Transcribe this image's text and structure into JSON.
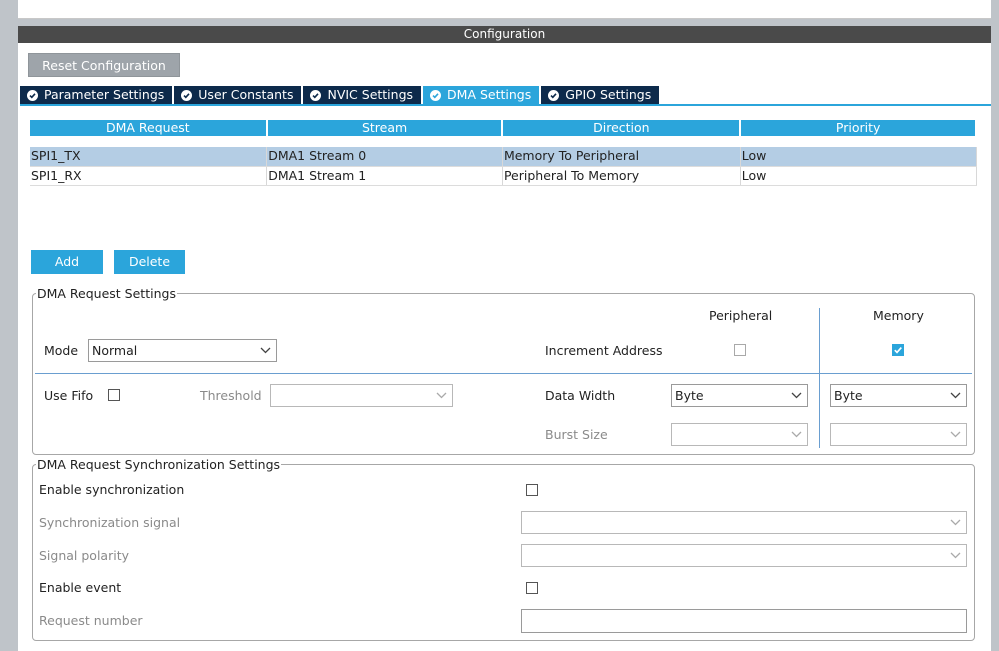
{
  "config": {
    "header": "Configuration",
    "reset_label": "Reset Configuration",
    "tabs": [
      {
        "label": "Parameter Settings"
      },
      {
        "label": "User Constants"
      },
      {
        "label": "NVIC Settings"
      },
      {
        "label": "DMA Settings",
        "active": true
      },
      {
        "label": "GPIO Settings"
      }
    ]
  },
  "dma_table": {
    "columns": [
      "DMA Request",
      "Stream",
      "Direction",
      "Priority"
    ],
    "rows": [
      {
        "request": "SPI1_TX",
        "stream": "DMA1 Stream 0",
        "direction": "Memory To Peripheral",
        "priority": "Low",
        "selected": true
      },
      {
        "request": "SPI1_RX",
        "stream": "DMA1 Stream 1",
        "direction": "Peripheral To Memory",
        "priority": "Low",
        "selected": false
      }
    ]
  },
  "buttons": {
    "add": "Add",
    "delete": "Delete"
  },
  "request_settings": {
    "title": "DMA Request Settings",
    "peripheral_header": "Peripheral",
    "memory_header": "Memory",
    "mode_label": "Mode",
    "mode_value": "Normal",
    "increment_label": "Increment Address",
    "peripheral_increment": false,
    "memory_increment": true,
    "use_fifo_label": "Use Fifo",
    "use_fifo": false,
    "threshold_label": "Threshold",
    "threshold_value": "",
    "data_width_label": "Data Width",
    "peripheral_width": "Byte",
    "memory_width": "Byte",
    "burst_label": "Burst Size",
    "peripheral_burst": "",
    "memory_burst": ""
  },
  "sync_settings": {
    "title": "DMA Request Synchronization Settings",
    "enable_sync_label": "Enable synchronization",
    "enable_sync": false,
    "sync_signal_label": "Synchronization signal",
    "sync_signal_value": "",
    "polarity_label": "Signal polarity",
    "polarity_value": "",
    "enable_event_label": "Enable event",
    "enable_event": false,
    "request_number_label": "Request number",
    "request_number_value": ""
  },
  "colors": {
    "accent": "#2ba5db",
    "tab_dark": "#0d2a4b",
    "selected_row": "#b4cde4",
    "header_bar": "#4a4a4a",
    "reset_button": "#9ea4aa",
    "window_bg": "#bfc4c9"
  },
  "icons": {
    "tab_status": "check-circle-icon",
    "dropdown": "chevron-down-icon"
  }
}
